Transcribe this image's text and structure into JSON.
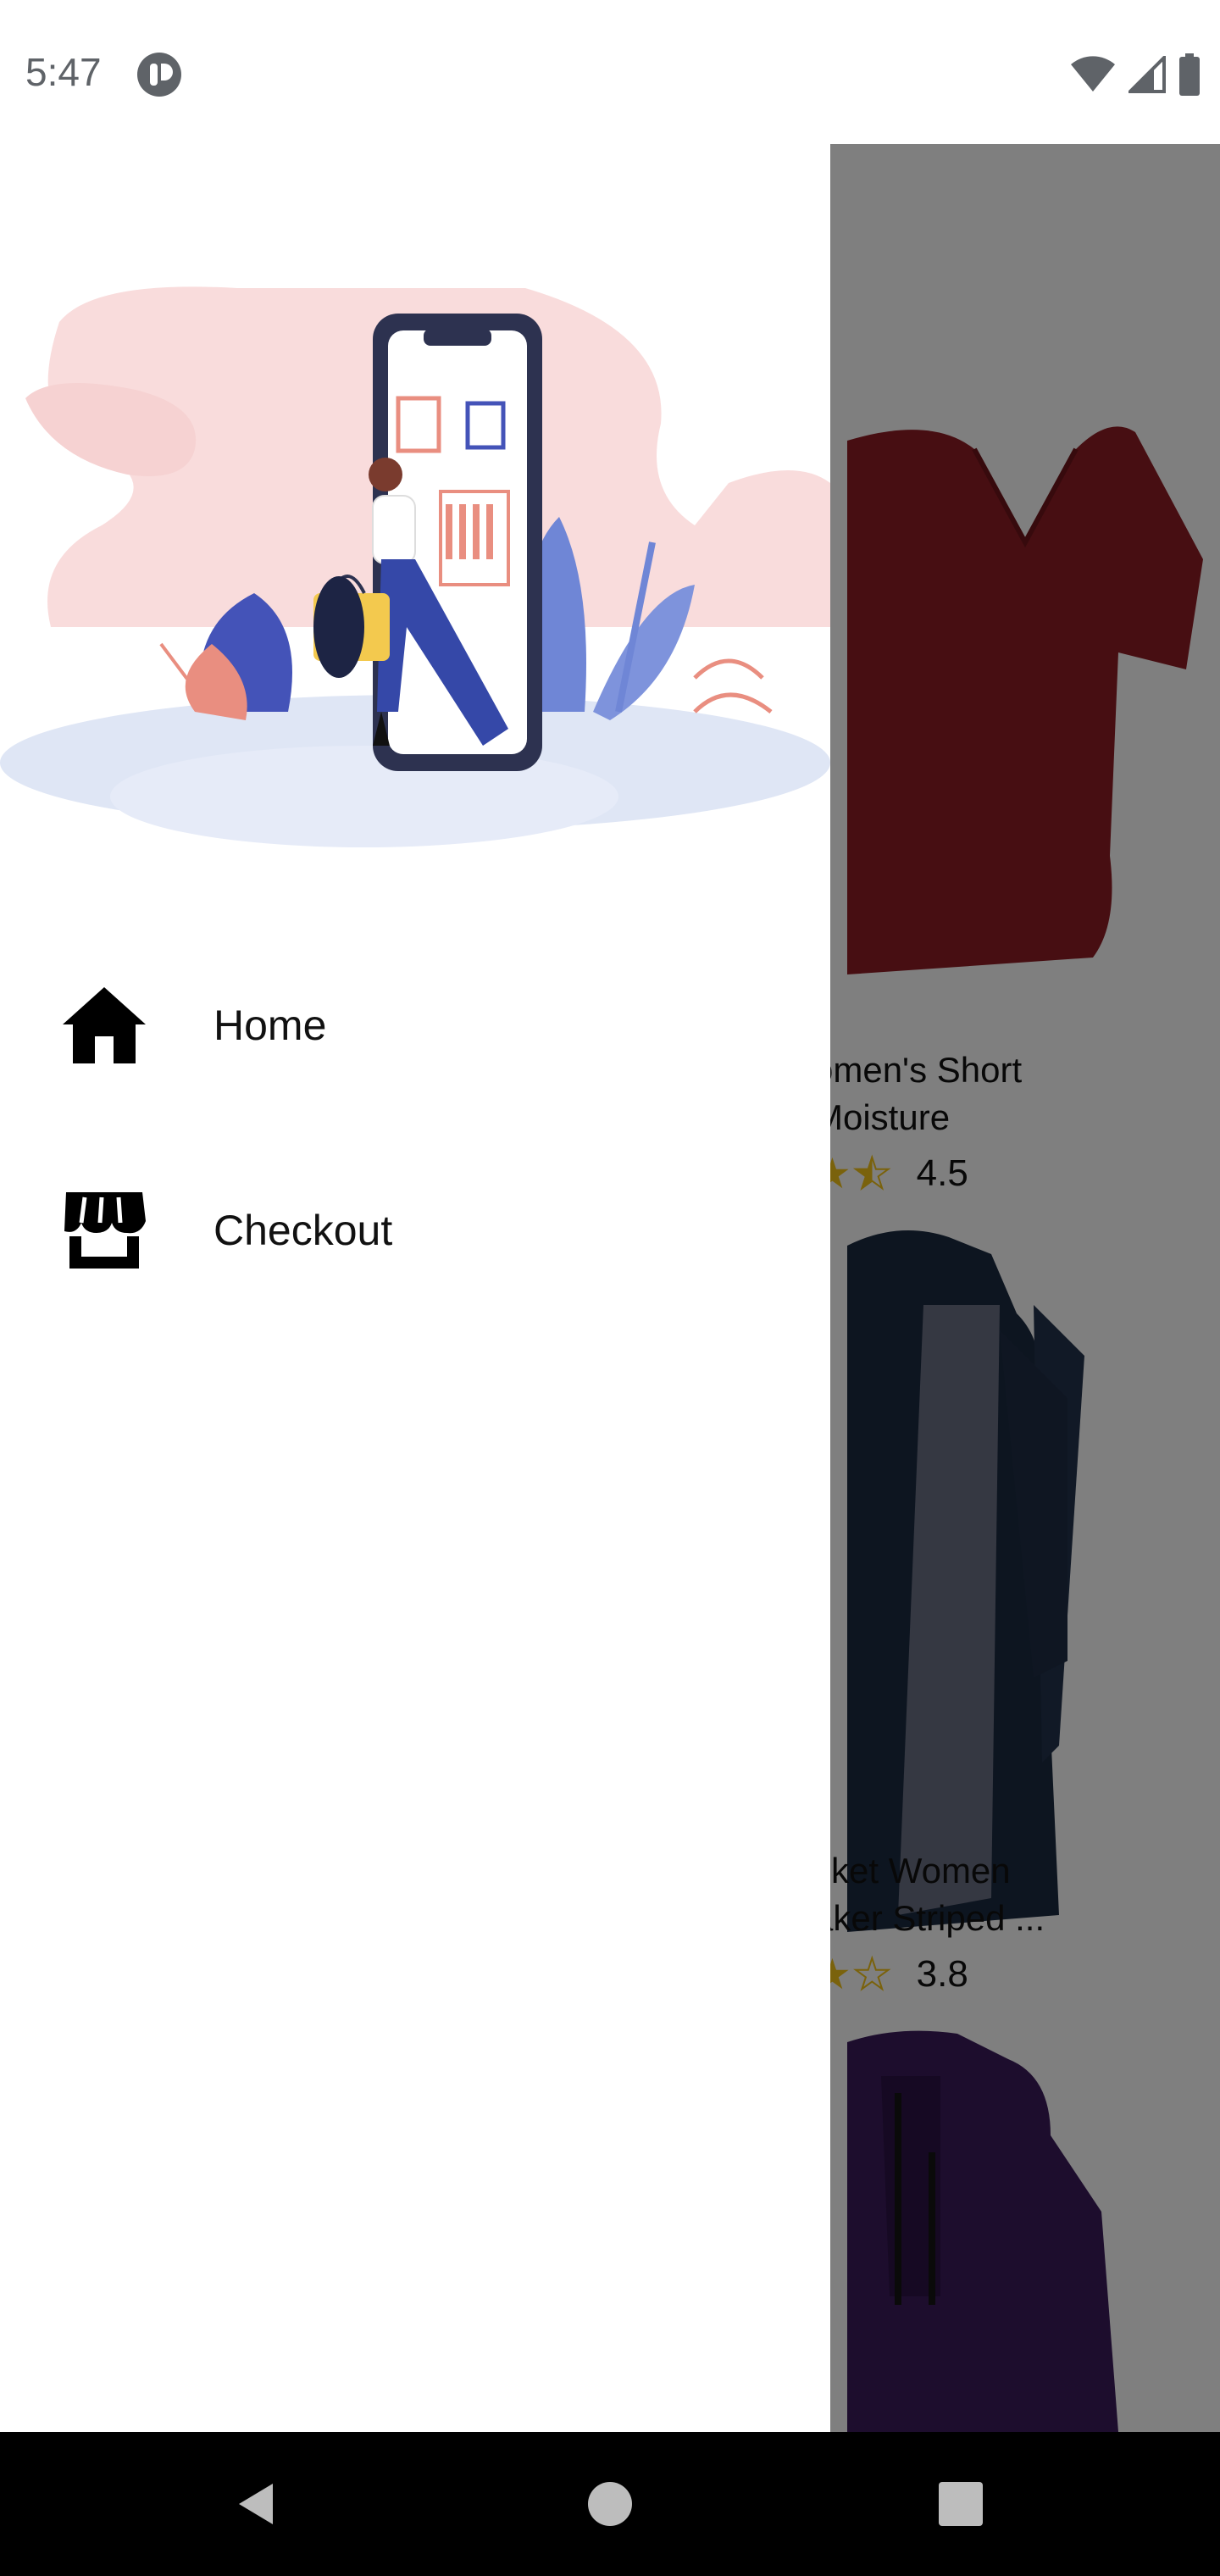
{
  "status_bar": {
    "time": "5:47",
    "icons": [
      "app-notification-icon",
      "wifi-icon",
      "cellular-signal-icon",
      "battery-icon"
    ]
  },
  "drawer": {
    "hero_image": "shopping-illustration",
    "items": [
      {
        "label": "Home",
        "icon": "home-icon"
      },
      {
        "label": "Checkout",
        "icon": "storefront-icon"
      }
    ]
  },
  "background_list": {
    "products": [
      {
        "title_line1": "omen's Short",
        "title_line2": "Moisture",
        "rating": 4.5,
        "rating_text": "4.5",
        "image": "red-tshirt",
        "color": "#8f1d24"
      },
      {
        "title_line1": "cket Women",
        "title_line2": "aker Striped ...",
        "rating": 3.8,
        "rating_text": "3.8",
        "image": "navy-jacket",
        "color": "#1b2a40"
      },
      {
        "title_line1": "",
        "title_line2": "",
        "image": "purple-jacket",
        "color": "#3a1a5a"
      }
    ]
  },
  "colors": {
    "scrim": "rgba(0,0,0,0.5)",
    "star": "#f5c518",
    "nav_bar": "#000000"
  },
  "nav_bar": {
    "buttons": [
      "back-button",
      "home-button",
      "recents-button"
    ]
  }
}
